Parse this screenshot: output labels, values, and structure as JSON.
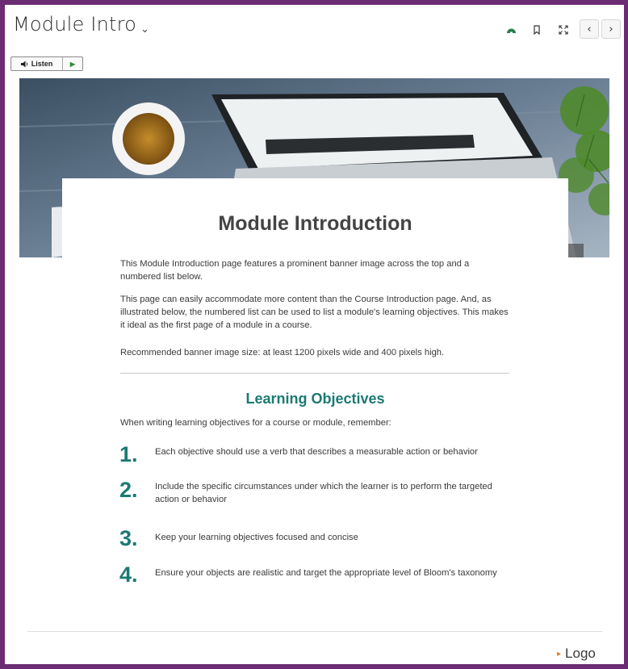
{
  "header": {
    "title": "Module Intro",
    "chevron": "⌄",
    "icons": [
      "progress-icon",
      "bookmark-icon",
      "fullscreen-icon"
    ],
    "prev_glyph": "‹",
    "next_glyph": "›"
  },
  "listen": {
    "label": "Listen",
    "play_glyph": "▶"
  },
  "content": {
    "heading": "Module Introduction",
    "paragraphs": [
      "This Module Introduction page features a prominent banner image across the top and a numbered list below.",
      "This page can easily accommodate more content than the Course Introduction page. And, as illustrated below, the numbered list can be used to list a module's learning objectives. This makes it ideal as the first page of a module in a course.",
      "Recommended banner image size: at least 1200 pixels wide and 400 pixels high."
    ],
    "subheading": "Learning Objectives",
    "intro": "When writing learning objectives for a course or module, remember:",
    "objectives": [
      {
        "num": "1.",
        "text": "Each objective should use a verb that describes a measurable action or behavior"
      },
      {
        "num": "2.",
        "text": "Include the specific circumstances under which the learner is to perform the targeted action or behavior"
      },
      {
        "num": "3.",
        "text": "Keep your learning objectives focused and concise"
      },
      {
        "num": "4.",
        "text": "Ensure your objects are realistic and target the appropriate level of Bloom's taxonomy"
      }
    ]
  },
  "footer": {
    "logo_label": "Logo",
    "logo_glyph": "▸"
  },
  "colors": {
    "frame": "#6b2c73",
    "accent": "#1b7a73",
    "progress_green": "#2e7d4f",
    "logo_arrow": "#e07a1a"
  }
}
